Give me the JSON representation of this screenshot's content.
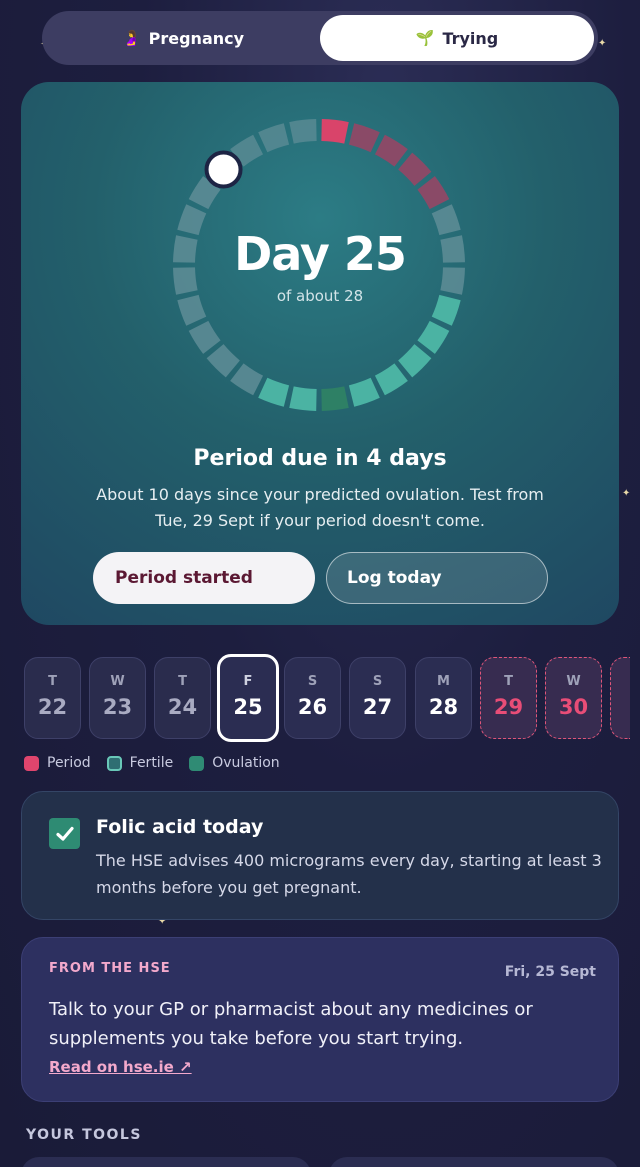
{
  "mode_toggle": {
    "options": [
      {
        "icon": "pregnant-person-icon",
        "label": "Pregnancy",
        "active": false
      },
      {
        "icon": "seedling-icon",
        "label": "Trying",
        "active": true
      }
    ]
  },
  "cycle": {
    "day_label": "Day 25",
    "of_label": "of about 28",
    "current_day": 25,
    "cycle_length": 28,
    "due_title": "Period due in 4 days",
    "due_description": "About 10 days since your predicted ovulation. Test from Tue, 29 Sept if your period doesn't come.",
    "period_started_label": "Period started",
    "log_today_label": "Log today"
  },
  "days": [
    {
      "dow": "T",
      "num": "22",
      "state": "past"
    },
    {
      "dow": "W",
      "num": "23",
      "state": "past"
    },
    {
      "dow": "T",
      "num": "24",
      "state": "past"
    },
    {
      "dow": "F",
      "num": "25",
      "state": "today"
    },
    {
      "dow": "S",
      "num": "26",
      "state": "future"
    },
    {
      "dow": "S",
      "num": "27",
      "state": "future"
    },
    {
      "dow": "M",
      "num": "28",
      "state": "future"
    },
    {
      "dow": "T",
      "num": "29",
      "state": "period"
    },
    {
      "dow": "W",
      "num": "30",
      "state": "period"
    }
  ],
  "legend": [
    {
      "label": "Period",
      "color": "#e0456d"
    },
    {
      "label": "Fertile",
      "color": "#2f7f7a"
    },
    {
      "label": "Ovulation",
      "color": "#2f8b74"
    }
  ],
  "folic": {
    "title": "Folic acid today",
    "description": "The HSE advises 400 micrograms every day, starting at least 3 months before you get pregnant.",
    "checked": true
  },
  "hse": {
    "label": "FROM THE HSE",
    "date": "Fri, 25 Sept",
    "text": "Talk to your GP or pharmacist about any medicines or supplements you take before you start trying.",
    "link": "Read on hse.ie ↗"
  },
  "tools_title": "YOUR TOOLS",
  "colors": {
    "period": "#d9446a",
    "period_faded": "#8a4a67",
    "fertile": "#4bb3a3",
    "ovulation": "#2e8065",
    "neutral": "#5f8d97"
  }
}
